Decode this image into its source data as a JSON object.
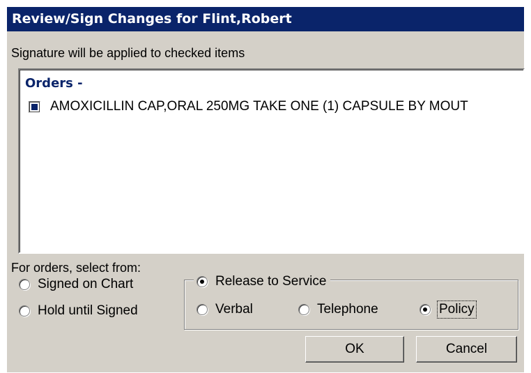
{
  "window": {
    "title": "Review/Sign Changes for Flint,Robert"
  },
  "signature_note": "Signature will be applied to checked items",
  "orders": {
    "header": "Orders -",
    "items": [
      {
        "label": "AMOXICILLIN CAP,ORAL  250MG TAKE ONE (1) CAPSULE BY MOUT",
        "checked": true
      }
    ]
  },
  "order_options": {
    "prompt": "For orders, select from:",
    "signed_on_chart": {
      "label": "Signed on Chart",
      "selected": false
    },
    "hold_until_signed": {
      "label": "Hold until Signed",
      "selected": false
    },
    "release_to_service": {
      "label": "Release to Service",
      "selected": true,
      "options": {
        "verbal": {
          "label": "Verbal",
          "selected": false
        },
        "telephone": {
          "label": "Telephone",
          "selected": false
        },
        "policy": {
          "label": "Policy",
          "selected": true
        }
      }
    }
  },
  "buttons": {
    "ok": "OK",
    "cancel": "Cancel"
  },
  "colors": {
    "titlebar": "#0a246a",
    "dialog_face": "#d4d0c8",
    "orders_header": "#0a246a"
  }
}
